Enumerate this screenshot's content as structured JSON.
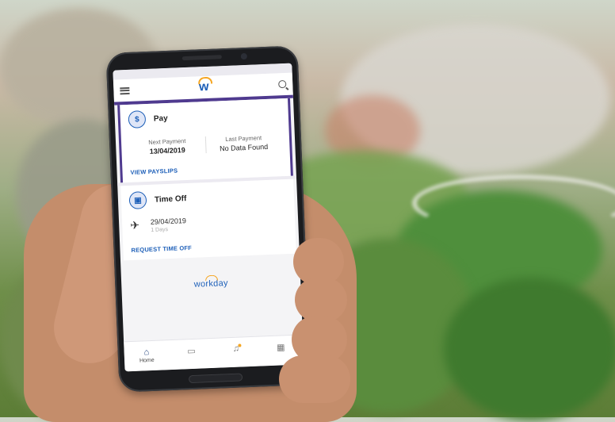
{
  "app": {
    "brand_letter": "w"
  },
  "pay": {
    "title": "Pay",
    "next_label": "Next Payment",
    "next_value": "13/04/2019",
    "last_label": "Last Payment",
    "last_value": "No Data Found",
    "link": "VIEW PAYSLIPS"
  },
  "time_off": {
    "title": "Time Off",
    "date": "29/04/2019",
    "days": "1 Days",
    "link": "REQUEST TIME OFF"
  },
  "footer": {
    "logo": "workday"
  },
  "tabs": [
    {
      "label": "Home",
      "icon": "home-icon"
    },
    {
      "label": "",
      "icon": "inbox-icon"
    },
    {
      "label": "",
      "icon": "bell-icon"
    },
    {
      "label": "",
      "icon": "apps-grid-icon"
    }
  ],
  "colors": {
    "accent": "#4f3a8f",
    "brand": "#1d5fb8",
    "logo_arc": "#f5a623"
  }
}
